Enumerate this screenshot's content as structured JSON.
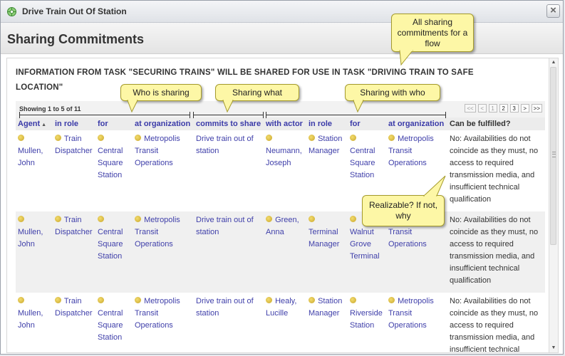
{
  "window": {
    "title": "Drive Train Out Of Station"
  },
  "header": {
    "title": "Sharing Commitments"
  },
  "info_text": "INFORMATION FROM TASK \"SECURING TRAINS\" WILL BE SHARED FOR USE IN TASK \"DRIVING TRAIN TO SAFE LOCATION\"",
  "pager": {
    "showing": "Showing 1 to 5 of 11",
    "first": "<<",
    "prev": "<",
    "pages": [
      "1",
      "2",
      "3"
    ],
    "next": ">",
    "last": ">>"
  },
  "columns": [
    "Agent",
    "in role",
    "for",
    "at organization",
    "commits to share",
    "with actor",
    "in role",
    "for",
    "at organization",
    "Can be fulfilled?"
  ],
  "rows": [
    {
      "agent": "Mullen, John",
      "role": "Train Dispatcher",
      "for": "Central Square Station",
      "org": "Metropolis Transit Operations",
      "info": "Drive train out of station",
      "actor": "Neumann, Joseph",
      "actor_role": "Station Manager",
      "actor_for": "Central Square Station",
      "actor_org": "Metropolis Transit Operations",
      "fulfilled": "No: Availabilities do not coincide as they must, no access to required transmission media, and insufficient technical qualification"
    },
    {
      "agent": "Mullen, John",
      "role": "Train Dispatcher",
      "for": "Central Square Station",
      "org": "Metropolis Transit Operations",
      "info": "Drive train out of station",
      "actor": "Green, Anna",
      "actor_role": "Terminal Manager",
      "actor_for": "Walnut Grove Terminal",
      "actor_org": "Metropolis Transit Operations",
      "fulfilled": "No: Availabilities do not coincide as they must, no access to required transmission media, and insufficient technical qualification"
    },
    {
      "agent": "Mullen, John",
      "role": "Train Dispatcher",
      "for": "Central Square Station",
      "org": "Metropolis Transit Operations",
      "info": "Drive train out of station",
      "actor": "Healy, Lucille",
      "actor_role": "Station Manager",
      "actor_for": "Riverside Station",
      "actor_org": "Metropolis Transit Operations",
      "fulfilled": "No: Availabilities do not coincide as they must, no access to required transmission media, and insufficient technical qualification"
    }
  ],
  "callouts": {
    "all_sharing": "All sharing commitments for a flow",
    "who_sharing": "Who is sharing",
    "sharing_what": "Sharing what",
    "sharing_with": "Sharing with who",
    "realizable": "Realizable? If not, why"
  },
  "colors": {
    "link": "#4040aa",
    "callout_bg": "#fdf7a6"
  }
}
